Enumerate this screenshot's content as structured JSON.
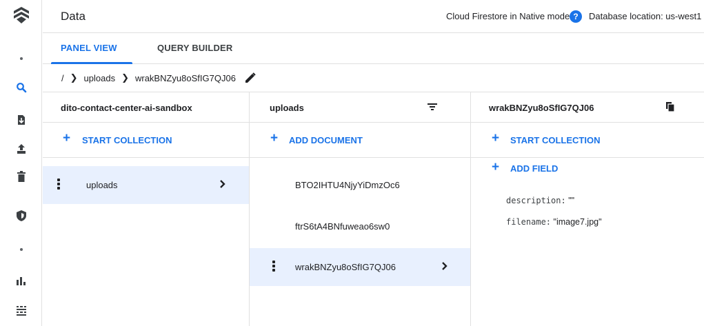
{
  "header": {
    "title": "Data",
    "mode": "Cloud Firestore in Native mode",
    "help_glyph": "?",
    "db_location": "Database location: us-west1"
  },
  "tabs": [
    {
      "label": "PANEL VIEW",
      "active": true
    },
    {
      "label": "QUERY BUILDER",
      "active": false
    }
  ],
  "breadcrumb": {
    "root": "/",
    "items": [
      "uploads",
      "wrakBNZyu8oSfIG7QJ06"
    ]
  },
  "columns": {
    "root": {
      "title": "dito-contact-center-ai-sandbox",
      "action": "START COLLECTION",
      "items": [
        {
          "label": "uploads",
          "selected": true
        }
      ]
    },
    "collection": {
      "title": "uploads",
      "action": "ADD DOCUMENT",
      "items": [
        {
          "label": "BTO2IHTU4NjyYiDmzOc6",
          "selected": false
        },
        {
          "label": "ftrS6tA4BNfuweao6sw0",
          "selected": false
        },
        {
          "label": "wrakBNZyu8oSfIG7QJ06",
          "selected": true
        }
      ]
    },
    "document": {
      "title": "wrakBNZyu8oSfIG7QJ06",
      "action": "START COLLECTION",
      "add_field": "ADD FIELD",
      "fields": [
        {
          "key": "description:",
          "value": "\"\""
        },
        {
          "key": "filename:",
          "value": "\"image7.jpg\""
        }
      ]
    }
  },
  "rail_icons": [
    "firestore-logo-icon",
    "dot-icon",
    "search-icon",
    "import-icon",
    "upload-icon",
    "delete-icon",
    "shield-icon",
    "dot-icon",
    "bar-chart-icon",
    "grid-icon"
  ],
  "colors": {
    "accent": "#1a73e8",
    "selected_bg": "#e8f0fe"
  }
}
